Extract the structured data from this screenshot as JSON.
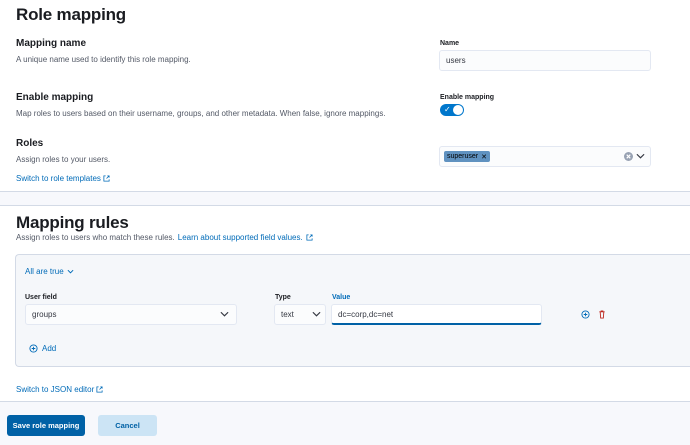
{
  "role_mapping": {
    "title": "Role mapping",
    "mapping_name": {
      "title": "Mapping name",
      "description": "A unique name used to identify this role mapping.",
      "field_label": "Name",
      "value": "users"
    },
    "enable_mapping": {
      "title": "Enable mapping",
      "description": "Map roles to users based on their username, groups, and other metadata. When false, ignore mappings.",
      "field_label": "Enable mapping",
      "enabled": true
    },
    "roles": {
      "title": "Roles",
      "description": "Assign roles to your users.",
      "selected": [
        "superuser"
      ],
      "switch_link": "Switch to role templates"
    }
  },
  "mapping_rules": {
    "title": "Mapping rules",
    "description": "Assign roles to users who match these rules.",
    "learn_link": "Learn about supported field values.",
    "group_operator": "All are true",
    "columns": {
      "user_field": "User field",
      "type": "Type",
      "value": "Value"
    },
    "rule": {
      "user_field": "groups",
      "type": "text",
      "value": "dc=corp,dc=net"
    },
    "add_label": "Add",
    "json_link": "Switch to JSON editor"
  },
  "actions": {
    "save": "Save role mapping",
    "cancel": "Cancel"
  },
  "colors": {
    "primary": "#0061a6",
    "link": "#006bb8",
    "toggle_on": "#0077cc",
    "badge": "#6092c0",
    "delete": "#bd271e"
  }
}
